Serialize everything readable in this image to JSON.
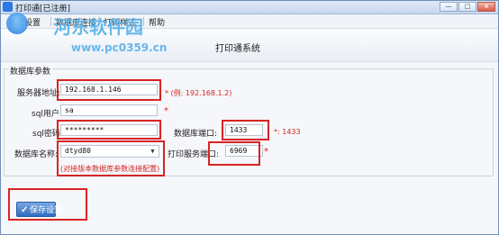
{
  "window": {
    "title": "打印通[已注册]",
    "controls": {
      "minimize": "—",
      "maximize": "□",
      "close": "×"
    }
  },
  "menu": {
    "items": [
      "系统设置",
      "数据库连接",
      "打印样式",
      "帮助"
    ]
  },
  "watermark": {
    "title": "河东软件园",
    "url": "www.pc0359.cn"
  },
  "header": {
    "title": "打印通系统"
  },
  "group": {
    "title": "数据库参数"
  },
  "form": {
    "server_label": "服务器地址:",
    "server_value": "192.168.1.146",
    "server_hint": "* (例: 192.168.1.2)",
    "user_label": "sql用户:",
    "user_value": "sa",
    "user_asterisk": "*",
    "password_label": "sql密码:",
    "password_value": "*********",
    "db_port_label": "数据库端口:",
    "db_port_value": "1433",
    "db_port_hint": "*: 1433",
    "db_name_label": "数据库名称:",
    "db_name_value": "dtyd80",
    "db_name_hint": "(对接版本数据库参数连接配置)",
    "print_port_label": "打印服务端口:",
    "print_port_value": "6969",
    "print_port_asterisk": "*"
  },
  "actions": {
    "save_label": "保存设置"
  }
}
